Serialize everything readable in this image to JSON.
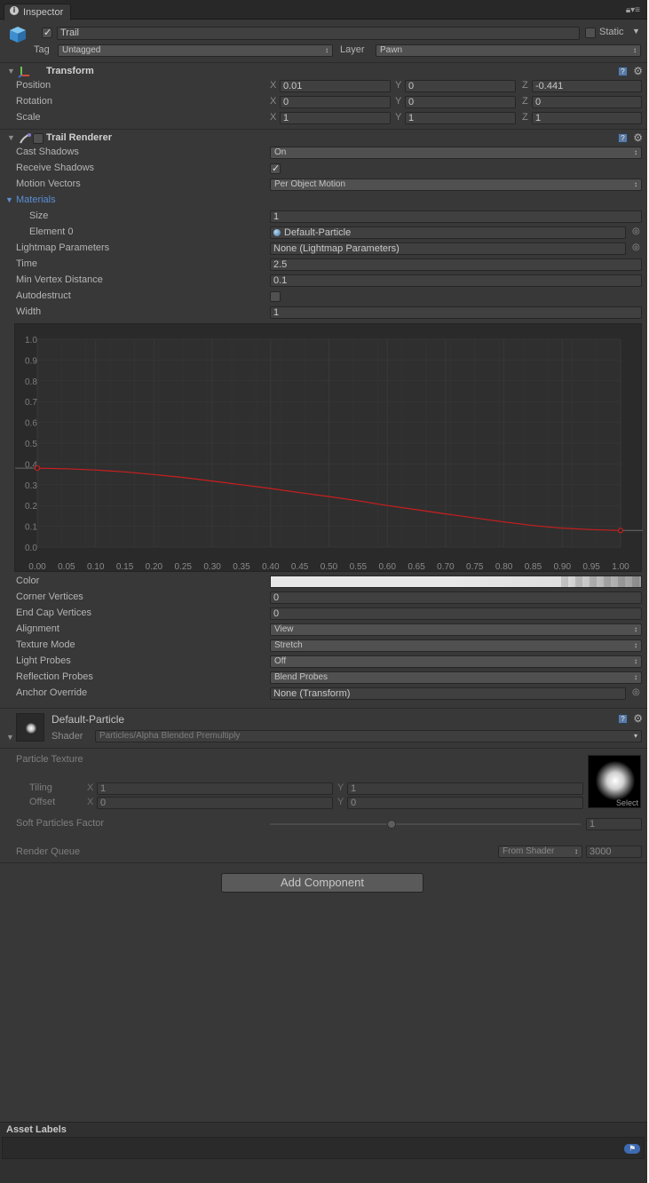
{
  "window": {
    "tab_title": "Inspector"
  },
  "gameobject": {
    "active": true,
    "name": "Trail",
    "static_label": "Static",
    "tag_label": "Tag",
    "tag_value": "Untagged",
    "layer_label": "Layer",
    "layer_value": "Pawn"
  },
  "transform": {
    "title": "Transform",
    "rows": [
      {
        "label": "Position",
        "x": "0.01",
        "y": "0",
        "z": "-0.441"
      },
      {
        "label": "Rotation",
        "x": "0",
        "y": "0",
        "z": "0"
      },
      {
        "label": "Scale",
        "x": "1",
        "y": "1",
        "z": "1"
      }
    ],
    "axis_x": "X",
    "axis_y": "Y",
    "axis_z": "Z"
  },
  "trail": {
    "title": "Trail Renderer",
    "cast_shadows_label": "Cast Shadows",
    "cast_shadows_value": "On",
    "receive_shadows_label": "Receive Shadows",
    "receive_shadows_checked": true,
    "motion_vectors_label": "Motion Vectors",
    "motion_vectors_value": "Per Object Motion",
    "materials_label": "Materials",
    "size_label": "Size",
    "size_value": "1",
    "element0_label": "Element 0",
    "element0_value": "Default-Particle",
    "lightmap_label": "Lightmap Parameters",
    "lightmap_value": "None (Lightmap Parameters)",
    "time_label": "Time",
    "time_value": "2.5",
    "min_vertex_label": "Min Vertex Distance",
    "min_vertex_value": "0.1",
    "autodestruct_label": "Autodestruct",
    "autodestruct_checked": false,
    "width_label": "Width",
    "width_value": "1",
    "color_label": "Color",
    "corner_label": "Corner Vertices",
    "corner_value": "0",
    "endcap_label": "End Cap Vertices",
    "endcap_value": "0",
    "alignment_label": "Alignment",
    "alignment_value": "View",
    "texture_mode_label": "Texture Mode",
    "texture_mode_value": "Stretch",
    "light_probes_label": "Light Probes",
    "light_probes_value": "Off",
    "reflection_label": "Reflection Probes",
    "reflection_value": "Blend Probes",
    "anchor_label": "Anchor Override",
    "anchor_value": "None (Transform)"
  },
  "chart_data": {
    "type": "line",
    "title": "",
    "xlabel": "",
    "ylabel": "",
    "xlim": [
      0,
      1
    ],
    "ylim": [
      0,
      1
    ],
    "x_ticks": [
      "0.00",
      "0.05",
      "0.10",
      "0.15",
      "0.20",
      "0.25",
      "0.30",
      "0.35",
      "0.40",
      "0.45",
      "0.50",
      "0.55",
      "0.60",
      "0.65",
      "0.70",
      "0.75",
      "0.80",
      "0.85",
      "0.90",
      "0.95",
      "1.00"
    ],
    "y_ticks": [
      "0.0",
      "0.1",
      "0.2",
      "0.3",
      "0.4",
      "0.5",
      "0.6",
      "0.7",
      "0.8",
      "0.9",
      "1.0"
    ],
    "grid": true,
    "series": [
      {
        "color": "#cc1e1e",
        "keys": [
          {
            "x": 0.0,
            "y": 0.38
          },
          {
            "x": 1.0,
            "y": 0.08
          }
        ],
        "x": [
          0.0,
          0.05,
          0.1,
          0.15,
          0.2,
          0.25,
          0.3,
          0.35,
          0.4,
          0.45,
          0.5,
          0.55,
          0.6,
          0.65,
          0.7,
          0.75,
          0.8,
          0.85,
          0.9,
          0.95,
          1.0
        ],
        "y": [
          0.38,
          0.377,
          0.371,
          0.362,
          0.349,
          0.335,
          0.318,
          0.3,
          0.282,
          0.262,
          0.243,
          0.223,
          0.2,
          0.18,
          0.16,
          0.14,
          0.121,
          0.104,
          0.091,
          0.084,
          0.08
        ]
      }
    ]
  },
  "material": {
    "name": "Default-Particle",
    "shader_label": "Shader",
    "shader_value": "Particles/Alpha Blended Premultiply",
    "particle_texture_label": "Particle Texture",
    "tiling_label": "Tiling",
    "tiling_x": "1",
    "tiling_y": "1",
    "offset_label": "Offset",
    "offset_x": "0",
    "offset_y": "0",
    "axis_x": "X",
    "axis_y": "Y",
    "select_label": "Select",
    "soft_label": "Soft Particles Factor",
    "soft_value": "1",
    "soft_fraction": 0.39,
    "queue_label": "Render Queue",
    "queue_mode": "From Shader",
    "queue_value": "3000"
  },
  "add_component_label": "Add Component",
  "asset_labels_title": "Asset Labels",
  "colors": {
    "curve": "#cc1e1e",
    "materials_link": "#5a8fd6",
    "background": "#383838"
  }
}
